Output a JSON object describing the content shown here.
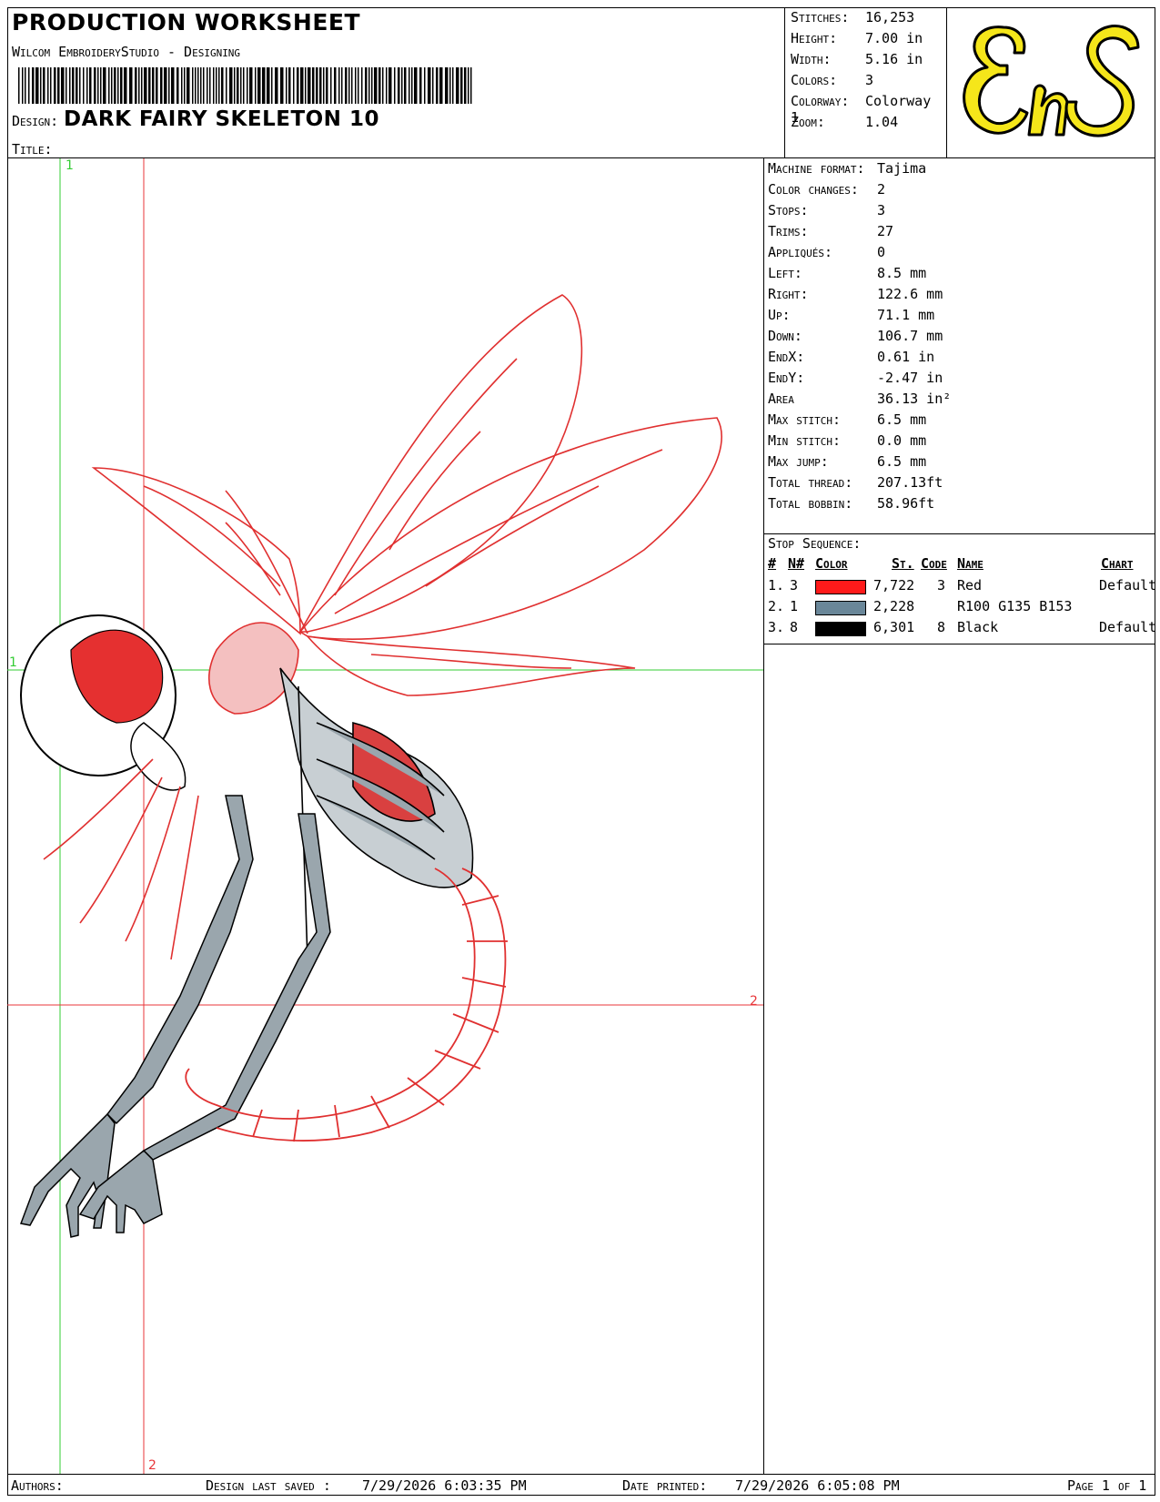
{
  "header": {
    "title": "PRODUCTION WORKSHEET",
    "software": "Wilcom EmbroideryStudio - Designing",
    "design_label": "Design:",
    "design_name": "DARK FAIRY SKELETON 10",
    "title_label": "Title:"
  },
  "summary": [
    {
      "label": "Stitches:",
      "value": "16,253"
    },
    {
      "label": "Height:",
      "value": "7.00 in"
    },
    {
      "label": "Width:",
      "value": "5.16 in"
    },
    {
      "label": "Colors:",
      "value": "3"
    },
    {
      "label": "Colorway:",
      "value": "Colorway 1"
    },
    {
      "label": "Zoom:",
      "value": "1.04"
    }
  ],
  "logo": {
    "text": "EnS",
    "colors": {
      "fill": "#f5e61a",
      "stroke": "#000000"
    }
  },
  "canvas": {
    "guides": {
      "green_vertical_label": "1",
      "green_horizontal_label": "1",
      "red_vertical_label": "2",
      "red_horizontal_label": "2"
    },
    "colors": {
      "green": "#33cc33",
      "red": "#e8363a"
    }
  },
  "machine": [
    {
      "label": "Machine format:",
      "value": "Tajima"
    },
    {
      "label": "Color changes:",
      "value": "2"
    },
    {
      "label": "Stops:",
      "value": "3"
    },
    {
      "label": "Trims:",
      "value": "27"
    },
    {
      "label": "Appliqués:",
      "value": "0"
    },
    {
      "label": "Left:",
      "value": "8.5 mm"
    },
    {
      "label": "Right:",
      "value": "122.6 mm"
    },
    {
      "label": "Up:",
      "value": "71.1 mm"
    },
    {
      "label": "Down:",
      "value": "106.7 mm"
    },
    {
      "label": "EndX:",
      "value": "0.61 in"
    },
    {
      "label": "EndY:",
      "value": "-2.47 in"
    },
    {
      "label": "Area",
      "value": "36.13 in²"
    },
    {
      "label": "Max stitch:",
      "value": "6.5 mm"
    },
    {
      "label": "Min stitch:",
      "value": "0.0 mm"
    },
    {
      "label": "Max jump:",
      "value": "6.5 mm"
    },
    {
      "label": "Total thread:",
      "value": "207.13ft"
    },
    {
      "label": "Total bobbin:",
      "value": "58.96ft"
    }
  ],
  "stop_sequence": {
    "title": "Stop Sequence:",
    "headers": {
      "num": "#",
      "n": "N#",
      "color": "Color",
      "st": "St.",
      "code": "Code",
      "name": "Name",
      "chart": "Chart"
    },
    "rows": [
      {
        "num": "1.",
        "n": "3",
        "swatch": "#ff1a1a",
        "st": "7,722",
        "code": "3",
        "name": "Red",
        "chart": "Default"
      },
      {
        "num": "2.",
        "n": "1",
        "swatch": "#6a8799",
        "st": "2,228",
        "code": "",
        "name": "R100 G135 B153",
        "chart": ""
      },
      {
        "num": "3.",
        "n": "8",
        "swatch": "#000000",
        "st": "6,301",
        "code": "8",
        "name": "Black",
        "chart": "Default"
      }
    ]
  },
  "footer": {
    "authors_label": "Authors:",
    "saved_label": "Design last saved :",
    "saved_value": "7/29/2026 6:03:35 PM",
    "printed_label": "Date printed:",
    "printed_value": "7/29/2026 6:05:08 PM",
    "page_label": "Page 1 of 1"
  }
}
